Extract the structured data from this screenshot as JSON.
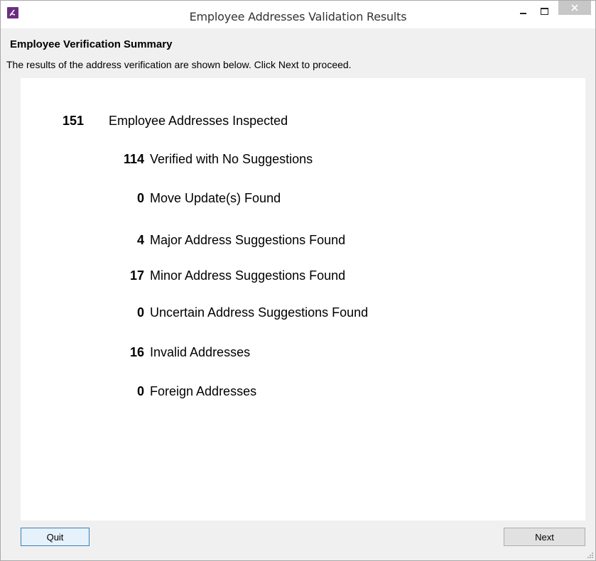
{
  "window": {
    "title": "Employee Addresses Validation Results",
    "icon": "app-logo-icon",
    "controls": [
      "minimize-icon",
      "maximize-icon",
      "close-icon"
    ]
  },
  "header": {
    "title": "Employee Verification Summary",
    "description": "The results of the address verification are shown below. Click Next to proceed."
  },
  "summary": {
    "total": {
      "count": "151",
      "label": "Employee Addresses Inspected"
    },
    "rows": [
      {
        "count": "114",
        "label": "Verified with No Suggestions"
      },
      {
        "count": "0",
        "label": "Move Update(s) Found"
      },
      {
        "count": "4",
        "label": "Major Address Suggestions Found"
      },
      {
        "count": "17",
        "label": "Minor Address Suggestions Found"
      },
      {
        "count": "0",
        "label": "Uncertain Address Suggestions Found"
      },
      {
        "count": "16",
        "label": "Invalid Addresses"
      },
      {
        "count": "0",
        "label": "Foreign Addresses"
      }
    ]
  },
  "buttons": {
    "quit": "Quit",
    "next": "Next"
  },
  "colors": {
    "app_icon": "#6b2d83",
    "window_bg": "#f0f0f0",
    "content_bg": "#ffffff"
  }
}
